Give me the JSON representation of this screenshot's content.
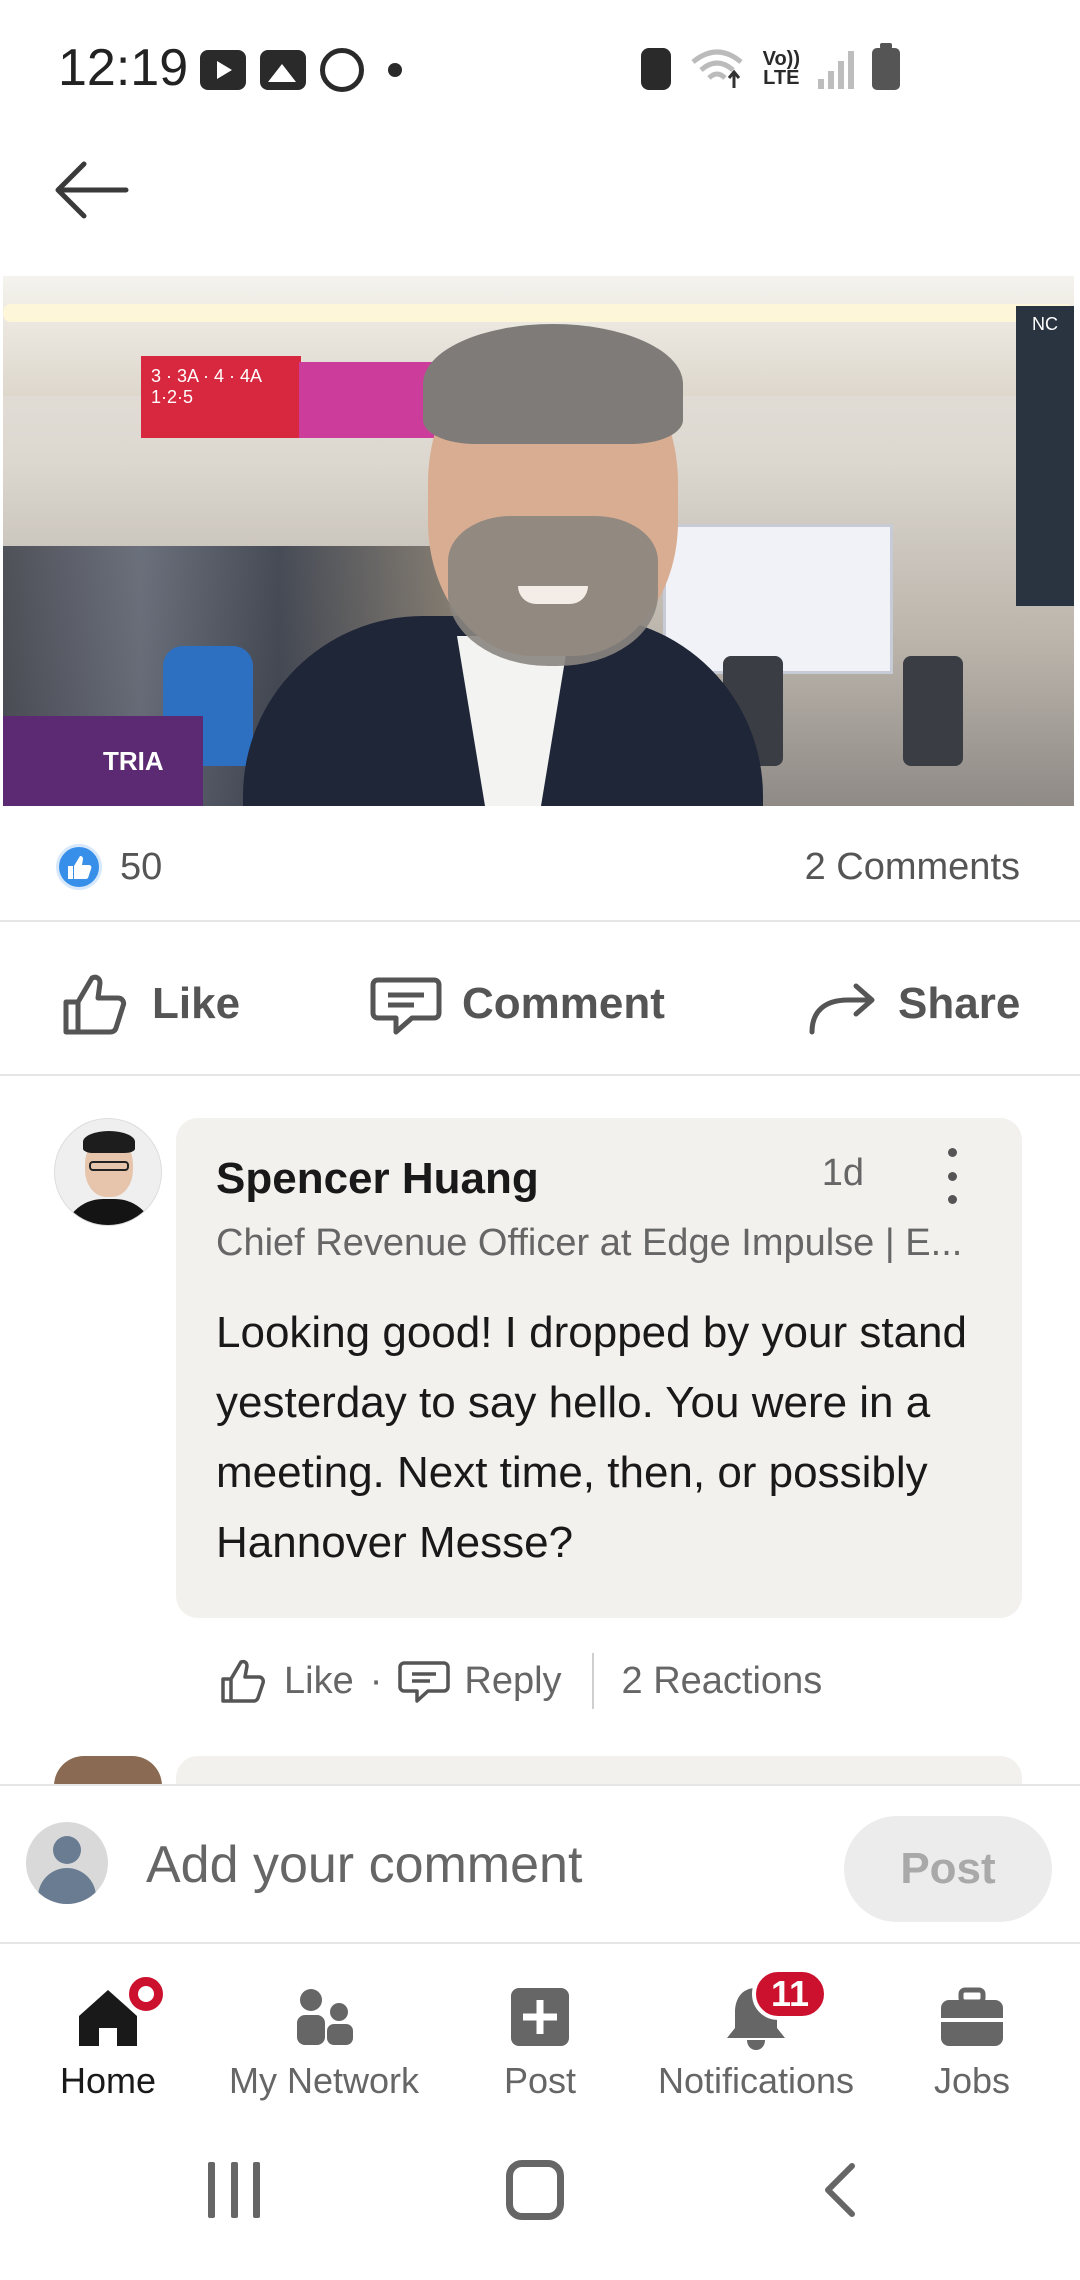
{
  "status_bar": {
    "time": "12:19",
    "left_icons": [
      "youtube-icon",
      "gallery-icon",
      "whatsapp-icon",
      "dot-icon"
    ],
    "right_icons": [
      "battery-saver-icon",
      "wifi-icon",
      "volte-icon",
      "signal-icon",
      "battery-icon"
    ],
    "volte_line1": "Vo))",
    "volte_line2": "LTE"
  },
  "header": {
    "back_icon": "arrow-left-icon"
  },
  "post": {
    "photo_sign_text": "3 · 3A · 4 · 4A  1·2·5",
    "photo_banner_text": "TRIA",
    "photo_right_sign": "NC",
    "reaction_icon": "like-reaction-icon",
    "reaction_count": "50",
    "comments_count": "2 Comments"
  },
  "actions": {
    "like": "Like",
    "comment": "Comment",
    "share": "Share"
  },
  "comments": [
    {
      "author": "Spencer Huang",
      "time": "1d",
      "headline": "Chief Revenue Officer at Edge Impulse | E...",
      "text": "Looking good! I dropped by your stand yesterday to say hello. You were in a meeting. Next time, then, or possibly Hannover Messe?",
      "like_label": "Like",
      "separator": "·",
      "reply_label": "Reply",
      "reactions_label": "2 Reactions"
    }
  ],
  "composer": {
    "placeholder": "Add your comment",
    "post_label": "Post"
  },
  "bottom_nav": {
    "items": [
      {
        "label": "Home",
        "icon": "home-icon",
        "active": true,
        "badge": "dot"
      },
      {
        "label": "My Network",
        "icon": "network-icon",
        "active": false
      },
      {
        "label": "Post",
        "icon": "post-plus-icon",
        "active": false
      },
      {
        "label": "Notifications",
        "icon": "bell-icon",
        "active": false,
        "badge_count": "11"
      },
      {
        "label": "Jobs",
        "icon": "briefcase-icon",
        "active": false
      }
    ]
  },
  "colors": {
    "accent_blue": "#378fe9",
    "badge_red": "#cb112d",
    "bubble_bg": "#f2f1ee",
    "text_secondary": "#666666"
  }
}
